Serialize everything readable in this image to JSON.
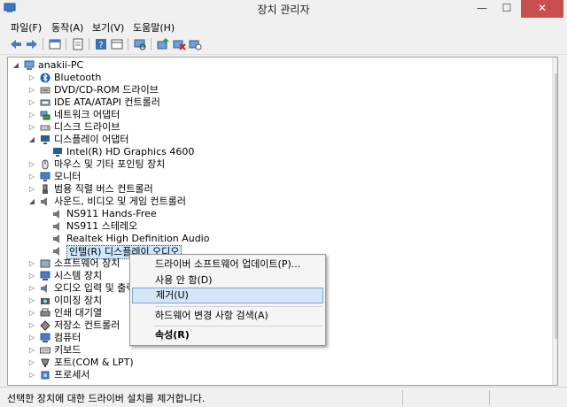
{
  "window": {
    "title": "장치 관리자",
    "min": "—",
    "max": "☐",
    "close": "✕"
  },
  "menu": [
    "파일(F)",
    "동작(A)",
    "보기(V)",
    "도움말(H)"
  ],
  "tree": {
    "root": "anakii-PC",
    "items": [
      "Bluetooth",
      "DVD/CD-ROM 드라이브",
      "IDE ATA/ATAPI 컨트롤러",
      "네트워크 어댑터",
      "디스크 드라이브",
      "디스플레이 어댑터",
      "Intel(R) HD Graphics 4600",
      "마우스 및 기타 포인팅 장치",
      "모니터",
      "범용 직렬 버스 컨트롤러",
      "사운드, 비디오 및 게임 컨트롤러",
      "NS911 Hands-Free",
      "NS911 스테레오",
      "Realtek High Definition Audio",
      "인텔(R) 디스플레이 오디오",
      "소프트웨어 장치",
      "시스템 장치",
      "오디오 입력 및 출력",
      "이미징 장치",
      "인쇄 대기열",
      "저장소 컨트롤러",
      "컴퓨터",
      "키보드",
      "포트(COM & LPT)",
      "프로세서"
    ]
  },
  "context_menu": {
    "update": "드라이버 소프트웨어 업데이트(P)...",
    "disable": "사용 안 함(D)",
    "uninstall": "제거(U)",
    "scan": "하드웨어 변경 사항 검색(A)",
    "properties": "속성(R)"
  },
  "status": {
    "text": "선택한 장치에 대한 드라이버 설치를 제거합니다."
  },
  "colors": {
    "selection": "#cde8ff",
    "menu_highlight": "#d5e6f7",
    "close_button": "#c74f4f"
  }
}
